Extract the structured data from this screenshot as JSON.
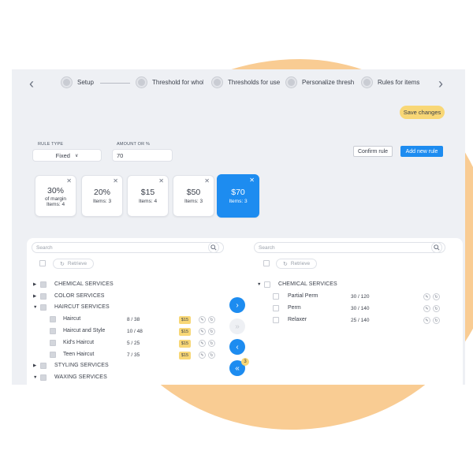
{
  "stepper": {
    "steps": [
      {
        "label": "Setup"
      },
      {
        "label": "Threshold for whole"
      },
      {
        "label": "Thresholds for user"
      },
      {
        "label": "Personalize thresho"
      },
      {
        "label": "Rules for items"
      }
    ],
    "prev_icon": "chevron-left-icon",
    "next_icon": "chevron-right-icon"
  },
  "save_changes_label": "Save changes",
  "rule_form": {
    "rule_type_label": "RULE TYPE",
    "rule_type_value": "Fixed",
    "amount_label": "AMOUNT OR %",
    "amount_value": "70",
    "confirm_label": "Confirm rule",
    "add_label": "Add new rule"
  },
  "rule_cards": [
    {
      "value": "30%",
      "line1": "of margin",
      "line2": "Items: 4",
      "active": false
    },
    {
      "value": "20%",
      "line1": "Items: 3",
      "active": false
    },
    {
      "value": "$15",
      "line1": "Items: 4",
      "active": false
    },
    {
      "value": "$50",
      "line1": "Items: 3",
      "active": false
    },
    {
      "value": "$70",
      "line1": "Items: 3",
      "active": true
    }
  ],
  "left_panel": {
    "search_placeholder": "Search",
    "retrieve_label": "Retrieve",
    "categories": [
      {
        "label": "CHEMICAL SERVICES",
        "expanded": false
      },
      {
        "label": "COLOR SERVICES",
        "expanded": false
      },
      {
        "label": "HAIRCUT SERVICES",
        "expanded": true
      },
      {
        "label": "STYLING SERVICES",
        "expanded": false
      },
      {
        "label": "WAXING SERVICES",
        "expanded": true
      }
    ],
    "items": [
      {
        "label": "Haircut",
        "count": "8 / 38",
        "price": "$15"
      },
      {
        "label": "Haircut and Style",
        "count": "10 / 48",
        "price": "$15"
      },
      {
        "label": "Kid's Haircut",
        "count": "5 / 25",
        "price": "$15"
      },
      {
        "label": "Teen Haircut",
        "count": "7 / 35",
        "price": "$15"
      }
    ]
  },
  "transfer": {
    "move_right_icon": "chevron-right-icon",
    "move_all_right_icon": "double-chevron-right-icon",
    "move_left_icon": "chevron-left-icon",
    "move_all_left_icon": "double-chevron-left-icon",
    "move_all_left_badge": "3"
  },
  "right_panel": {
    "search_placeholder": "Search",
    "retrieve_label": "Retrieve",
    "category": "CHEMICAL SERVICES",
    "items": [
      {
        "label": "Partial Perm",
        "count": "30 / 120"
      },
      {
        "label": "Perm",
        "count": "30 / 140"
      },
      {
        "label": "Relaxer",
        "count": "25 / 140"
      }
    ]
  },
  "colors": {
    "accent": "#1d8cf0",
    "highlight": "#f8d776",
    "backdrop_blob": "#f9cc93",
    "window_bg": "#eef0f4"
  }
}
